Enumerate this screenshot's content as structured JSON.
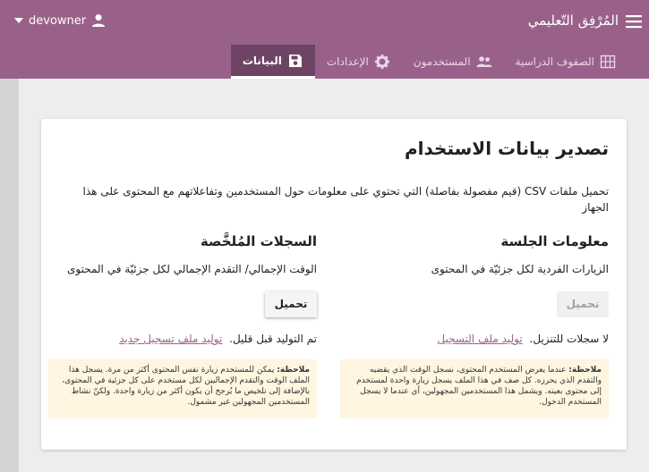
{
  "appbar": {
    "title": "المُرْفِق التّعليمي",
    "username": "devowner"
  },
  "tabs": [
    {
      "label": "الصفوف الدراسية",
      "icon": "classroom-icon",
      "active": false
    },
    {
      "label": "المستخدمون",
      "icon": "people-icon",
      "active": false
    },
    {
      "label": "الإعدادات",
      "icon": "gear-icon",
      "active": false
    },
    {
      "label": "البيانات",
      "icon": "save-icon",
      "active": true
    }
  ],
  "card": {
    "title": "تصدير بيانات الاستخدام",
    "description": "تحميل ملفات CSV (قيم مفصولة بفاصلة) التي تحتوي على معلومات حول المستخدمين وتفاعلاتهم مع المحتوى على هذا الجهاز"
  },
  "session": {
    "title": "معلومات الجلسة",
    "subtitle": "الزيارات الفردية لكل جزئيّة في المحتوى",
    "button": "تحميل",
    "status": "لا سجلات للتنزيل.",
    "link": "توليد ملف التسجيل",
    "note_label": "ملاحظة:",
    "note": "عندما يعرض المستخدم المحتوى، نسجل الوقت الذي يقضيه والتقدم الذي يحرزه. كل صف في هذا الملف يسجل زيارة واحدة لمستخدم إلى محتوى بعينه. ويشمل هذا المستخدمين المجهولين، أي عندما لا يسجل المستخدم الدخول."
  },
  "summary": {
    "title": "السجلات المُلخَّصة",
    "subtitle": "الوقت الإجمالي/ التقدم الإجمالي لكل جزئيّة في المحتوى",
    "button": "تحميل",
    "status": "تم التوليد قبل قليل.",
    "link": "توليد ملف تسجيل جديد",
    "note_label": "ملاحظة:",
    "note": "يمكن للمستخدم زيارة نفس المحتوى أكثر من مرة. يسجل هذا الملف الوقت والتقدم الإجماليين لكل مستخدم على كل جزئية في المحتوى، بالإضافة إلى تلخيص ما يُرجح أن يكون أكثر من زيارة واحدة. ولكنّ نشاط المستخدمين المجهولين غير مشمول."
  },
  "colors": {
    "appbar": "#996189",
    "active_tab": "#6e4464",
    "note_bg": "#fff5e0"
  }
}
